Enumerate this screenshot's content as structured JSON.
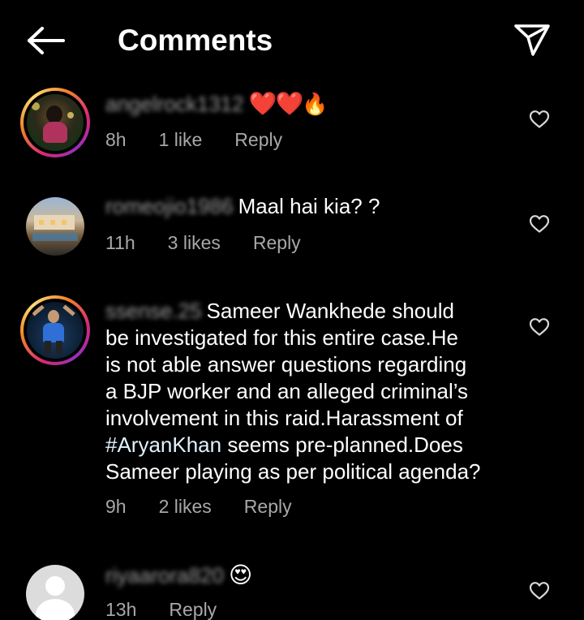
{
  "header": {
    "title": "Comments"
  },
  "comments": [
    {
      "username": "angelrock1312",
      "text": "",
      "emojis": [
        "❤️",
        "❤️",
        "🔥"
      ],
      "time": "8h",
      "likes": "1 like",
      "reply": "Reply"
    },
    {
      "username": "romeojio1986",
      "text": "Maal hai kia? ?",
      "time": "11h",
      "likes": "3 likes",
      "reply": "Reply"
    },
    {
      "username": "ssense.25",
      "text_line1": "Sameer Wankhede should",
      "text_line2": "be investigated for this entire case.He",
      "text_line3": "is not able answer questions regarding",
      "text_line4": "a BJP worker and an alleged criminal’s",
      "text_line5": "involvement in this raid.Harassment of",
      "text_hashtag": "#AryanKhan",
      "text_line6_rest": " seems pre-planned.Does",
      "text_line7": "Sameer playing as per political agenda?",
      "time": "9h",
      "likes": "2 likes",
      "reply": "Reply"
    },
    {
      "username": "riyaarora820",
      "emoji": "😍",
      "time": "13h",
      "reply": "Reply"
    }
  ],
  "icons": {
    "back": "back-arrow-icon",
    "share": "send-paper-plane-icon",
    "like": "heart-outline-icon"
  },
  "colors": {
    "background": "#000000",
    "text": "#ffffff",
    "meta": "#a8a8a8",
    "hashtag": "#e0f1ff"
  }
}
